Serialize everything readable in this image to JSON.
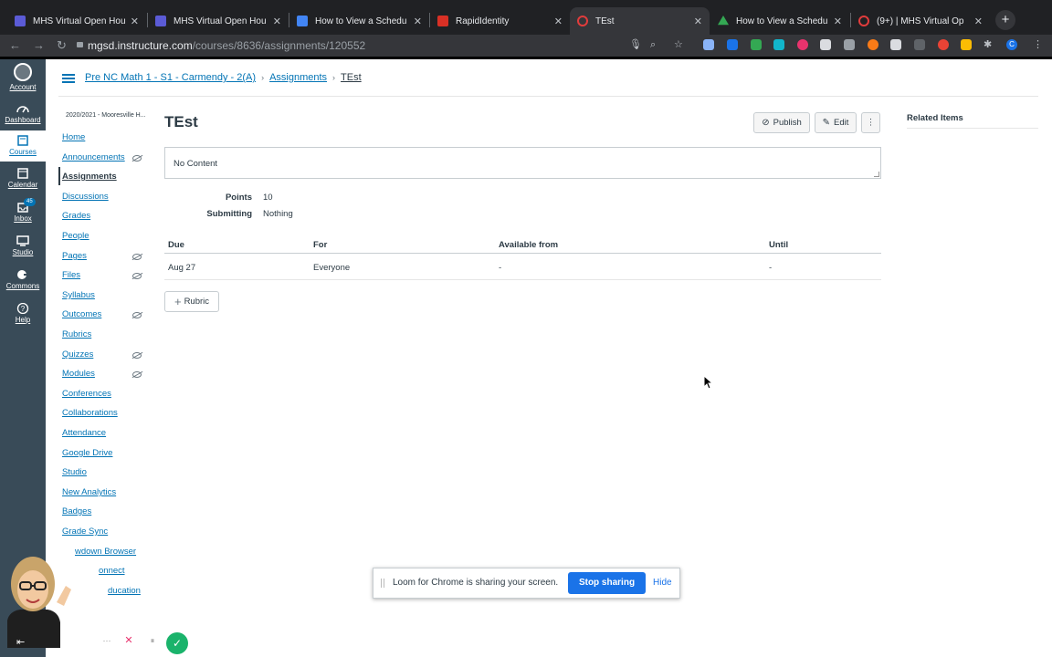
{
  "browser": {
    "tabs": [
      {
        "title": "MHS Virtual Open Hou",
        "favicon_color": "#5b5bd6",
        "active": false
      },
      {
        "title": "MHS Virtual Open Hou",
        "favicon_color": "#5b5bd6",
        "active": false
      },
      {
        "title": "How to View a Schedu",
        "favicon_color": "#4285f4",
        "active": false
      },
      {
        "title": "RapidIdentity",
        "favicon_color": "#d93025",
        "active": false
      },
      {
        "title": "TEst",
        "favicon_color": "#e13c3c",
        "active": true
      },
      {
        "title": "How to View a Schedu",
        "favicon_color": "#34a853",
        "active": false
      },
      {
        "title": "(9+) | MHS Virtual Op",
        "favicon_color": "#e13c3c",
        "active": false
      }
    ],
    "url_host": "mgsd.instructure.com",
    "url_path": "/courses/8636/assignments/120552",
    "profile_initial": "C"
  },
  "global_nav": {
    "items": [
      {
        "label": "Account",
        "icon": "account-avatar-icon"
      },
      {
        "label": "Dashboard",
        "icon": "dashboard-icon"
      },
      {
        "label": "Courses",
        "icon": "courses-icon"
      },
      {
        "label": "Calendar",
        "icon": "calendar-icon"
      },
      {
        "label": "Inbox",
        "icon": "inbox-icon",
        "badge": "45"
      },
      {
        "label": "Studio",
        "icon": "studio-icon"
      },
      {
        "label": "Commons",
        "icon": "commons-icon"
      },
      {
        "label": "Help",
        "icon": "help-icon"
      }
    ]
  },
  "breadcrumb": {
    "course": "Pre NC Math 1 - S1 - Carmendy - 2(A)",
    "section": "Assignments",
    "current": "TEst"
  },
  "course_nav": {
    "term": "2020/2021 - Mooresville H...",
    "items": [
      {
        "label": "Home",
        "hidden": false
      },
      {
        "label": "Announcements",
        "hidden": true
      },
      {
        "label": "Assignments",
        "hidden": false,
        "active": true
      },
      {
        "label": "Discussions",
        "hidden": false
      },
      {
        "label": "Grades",
        "hidden": false
      },
      {
        "label": "People",
        "hidden": false
      },
      {
        "label": "Pages",
        "hidden": true
      },
      {
        "label": "Files",
        "hidden": true
      },
      {
        "label": "Syllabus",
        "hidden": false
      },
      {
        "label": "Outcomes",
        "hidden": true
      },
      {
        "label": "Rubrics",
        "hidden": false
      },
      {
        "label": "Quizzes",
        "hidden": true
      },
      {
        "label": "Modules",
        "hidden": true
      },
      {
        "label": "Conferences",
        "hidden": false
      },
      {
        "label": "Collaborations",
        "hidden": false
      },
      {
        "label": "Attendance",
        "hidden": false
      },
      {
        "label": "Google Drive",
        "hidden": false
      },
      {
        "label": "Studio",
        "hidden": false
      },
      {
        "label": "New Analytics",
        "hidden": false
      },
      {
        "label": "Badges",
        "hidden": false
      },
      {
        "label": "Grade Sync",
        "hidden": false
      },
      {
        "label": "wdown Browser",
        "hidden": false
      },
      {
        "label": "onnect",
        "hidden": false
      },
      {
        "label": "ducation",
        "hidden": false
      }
    ]
  },
  "assignment": {
    "title": "TEst",
    "publish_label": "Publish",
    "edit_label": "Edit",
    "more_label": "⋮",
    "description": "No Content",
    "points_label": "Points",
    "points_value": "10",
    "submitting_label": "Submitting",
    "submitting_value": "Nothing",
    "table_headers": [
      "Due",
      "For",
      "Available from",
      "Until"
    ],
    "table_rows": [
      [
        "Aug 27",
        "Everyone",
        "-",
        "-"
      ]
    ],
    "rubric_label": "Rubric"
  },
  "sidebar_right": {
    "title": "Related Items"
  },
  "loom": {
    "message": "Loom for Chrome is sharing your screen.",
    "stop_label": "Stop sharing",
    "hide_label": "Hide"
  },
  "colors": {
    "link": "#0374b5",
    "global_nav_bg": "#394b58",
    "loom_blue": "#1a73e8"
  }
}
